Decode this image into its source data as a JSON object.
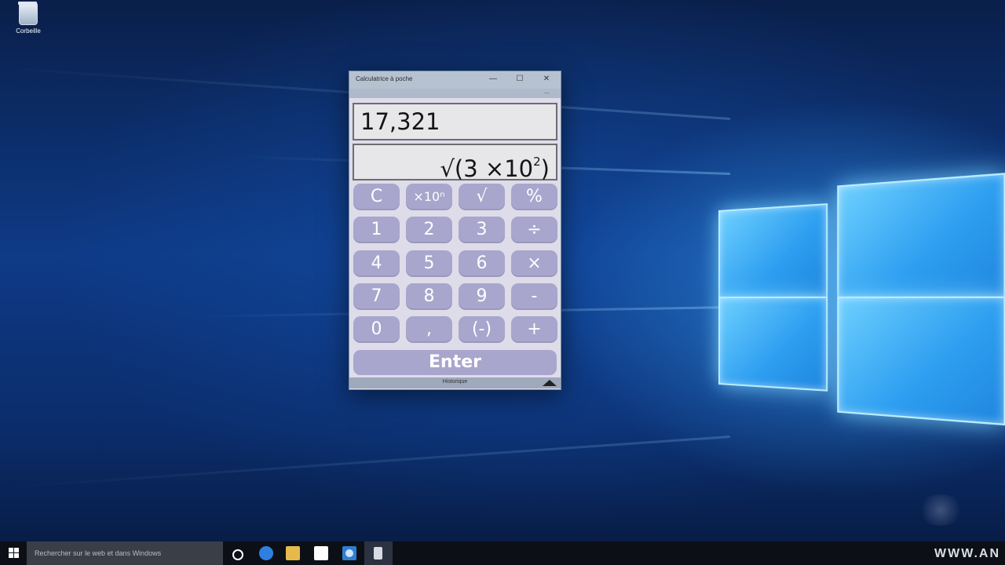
{
  "desktop": {
    "recycle_bin_label": "Corbeille"
  },
  "calculator": {
    "title": "Calculatrice à poche",
    "title_buttons": {
      "minimize": "—",
      "maximize": "☐",
      "close": "✕"
    },
    "more_label": "...",
    "result": "17,321",
    "expression": {
      "prefix": "√(3 ×10",
      "exponent": "2",
      "suffix": ")"
    },
    "keys": [
      [
        "C",
        "×10ⁿ",
        "√",
        "%"
      ],
      [
        "1",
        "2",
        "3",
        "÷"
      ],
      [
        "4",
        "5",
        "6",
        "×"
      ],
      [
        "7",
        "8",
        "9",
        "-"
      ],
      [
        "0",
        ",",
        "(-)",
        "+"
      ]
    ],
    "enter_label": "Enter",
    "history_label": "Historique",
    "colors": {
      "key": "#a8a6cd",
      "body": "#dedce9",
      "display": "#e7e6e8"
    }
  },
  "taskbar": {
    "search_placeholder": "Rechercher sur le web et dans Windows",
    "icons": [
      "start-icon",
      "task-view-icon",
      "edge-icon",
      "file-explorer-icon",
      "store-icon",
      "calculator-icon",
      "pocket-calculator-icon"
    ],
    "watermark": "WWW.AN"
  }
}
